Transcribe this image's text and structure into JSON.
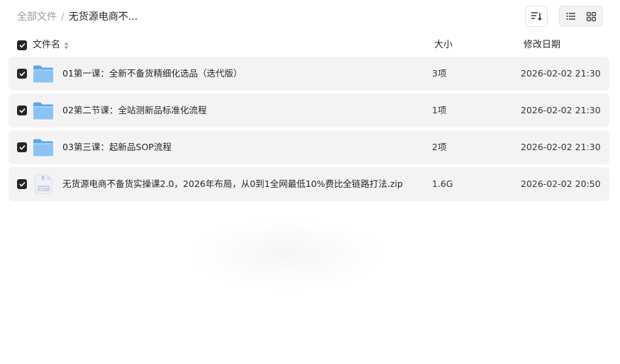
{
  "breadcrumb": {
    "root": "全部文件",
    "separator": "/",
    "current": "无货源电商不..."
  },
  "toolbar": {
    "sort_icon": "sort-lines-icon",
    "view_list_icon": "list-view-icon",
    "view_grid_icon": "grid-view-icon",
    "active_view": "grid"
  },
  "table": {
    "columns": {
      "name": "文件名",
      "size": "大小",
      "modified": "修改日期"
    },
    "rows": [
      {
        "name": "01第一课：全新不备货精细化选品（迭代版）",
        "size": "3项",
        "modified": "2026-02-02 21:30",
        "type": "folder",
        "checked": true
      },
      {
        "name": "02第二节课：全站测新品标准化流程",
        "size": "1项",
        "modified": "2026-02-02 21:30",
        "type": "folder",
        "checked": true
      },
      {
        "name": "03第三课：起新品SOP流程",
        "size": "2项",
        "modified": "2026-02-02 21:30",
        "type": "folder",
        "checked": true
      },
      {
        "name": "无货源电商不备货实操课2.0，2026年布局，从0到1全网最低10%费比全链路打法.zip",
        "size": "1.6G",
        "modified": "2026-02-02 20:50",
        "type": "zip",
        "checked": true
      }
    ]
  },
  "colors": {
    "row_background": "#f3f3f4",
    "checkbox": "#25262b",
    "folder": "#7cb8f2",
    "muted_text": "#9a9ca3"
  }
}
